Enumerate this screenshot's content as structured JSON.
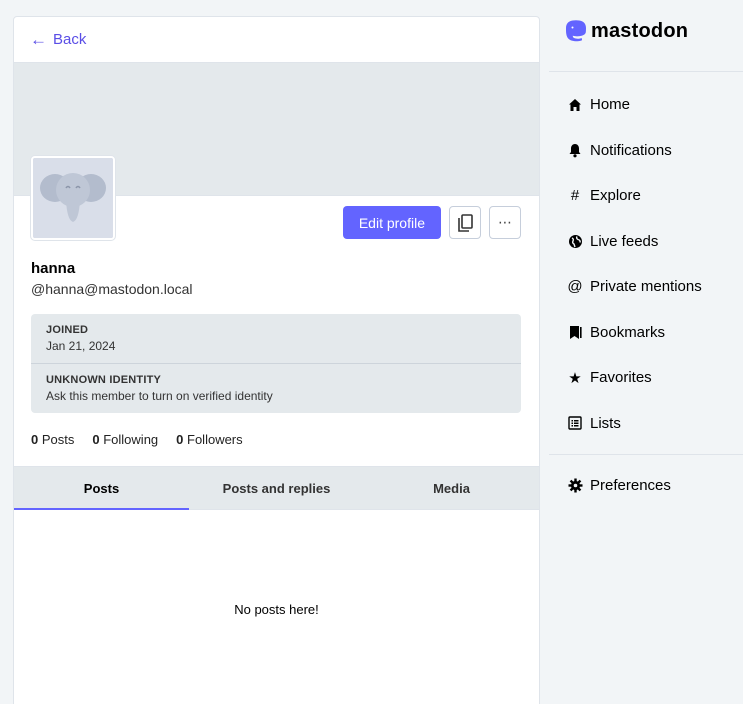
{
  "back": {
    "label": "Back"
  },
  "profile": {
    "display_name": "hanna",
    "acct": "@hanna@mastodon.local",
    "edit_label": "Edit profile",
    "fields": [
      {
        "key": "JOINED",
        "value": "Jan 21, 2024"
      },
      {
        "key": "UNKNOWN IDENTITY",
        "value": "Ask this member to turn on verified identity"
      }
    ],
    "counts": {
      "posts_num": "0",
      "posts_label": "Posts",
      "following_num": "0",
      "following_label": "Following",
      "followers_num": "0",
      "followers_label": "Followers"
    }
  },
  "tabs": [
    {
      "label": "Posts",
      "active": true
    },
    {
      "label": "Posts and replies"
    },
    {
      "label": "Media"
    }
  ],
  "empty_text": "No posts here!",
  "sidebar": {
    "logo_text": "mastodon",
    "items": [
      {
        "label": "Home",
        "icon": "home-icon"
      },
      {
        "label": "Notifications",
        "icon": "bell-icon"
      },
      {
        "label": "Explore",
        "icon": "hashtag-icon"
      },
      {
        "label": "Live feeds",
        "icon": "globe-icon"
      },
      {
        "label": "Private mentions",
        "icon": "at-icon"
      },
      {
        "label": "Bookmarks",
        "icon": "bookmark-icon"
      },
      {
        "label": "Favorites",
        "icon": "star-icon"
      },
      {
        "label": "Lists",
        "icon": "list-icon"
      }
    ],
    "preferences": {
      "label": "Preferences",
      "icon": "gear-icon"
    }
  },
  "colors": {
    "accent": "#6364ff",
    "link": "#5a4ee6",
    "panel": "#e4e9ec"
  }
}
